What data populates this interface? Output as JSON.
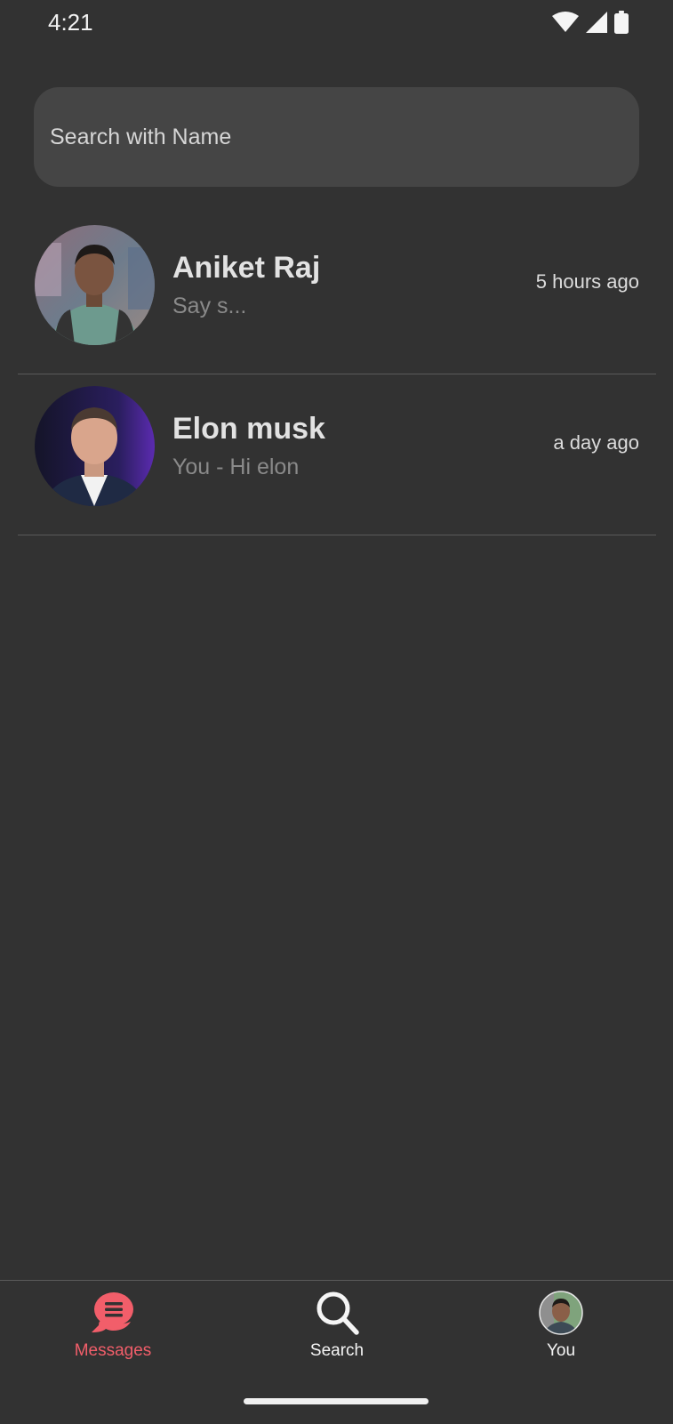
{
  "status_bar": {
    "time": "4:21",
    "icons": [
      "wifi-icon",
      "signal-icon",
      "battery-icon"
    ]
  },
  "search": {
    "placeholder": "Search with Name",
    "value": ""
  },
  "conversations": [
    {
      "name": "Aniket Raj",
      "preview": "Say s...",
      "time": "5 hours ago"
    },
    {
      "name": "Elon musk",
      "preview": "You - Hi elon",
      "time": "a day ago"
    }
  ],
  "bottom_nav": {
    "items": [
      {
        "label": "Messages",
        "icon": "messages-icon",
        "active": true
      },
      {
        "label": "Search",
        "icon": "search-icon",
        "active": false
      },
      {
        "label": "You",
        "icon": "profile-avatar",
        "active": false
      }
    ]
  },
  "colors": {
    "background": "#323232",
    "search_bg": "#454545",
    "accent": "#f25e6a",
    "divider": "#5a5a5a",
    "preview_text": "#8a8a8a"
  }
}
